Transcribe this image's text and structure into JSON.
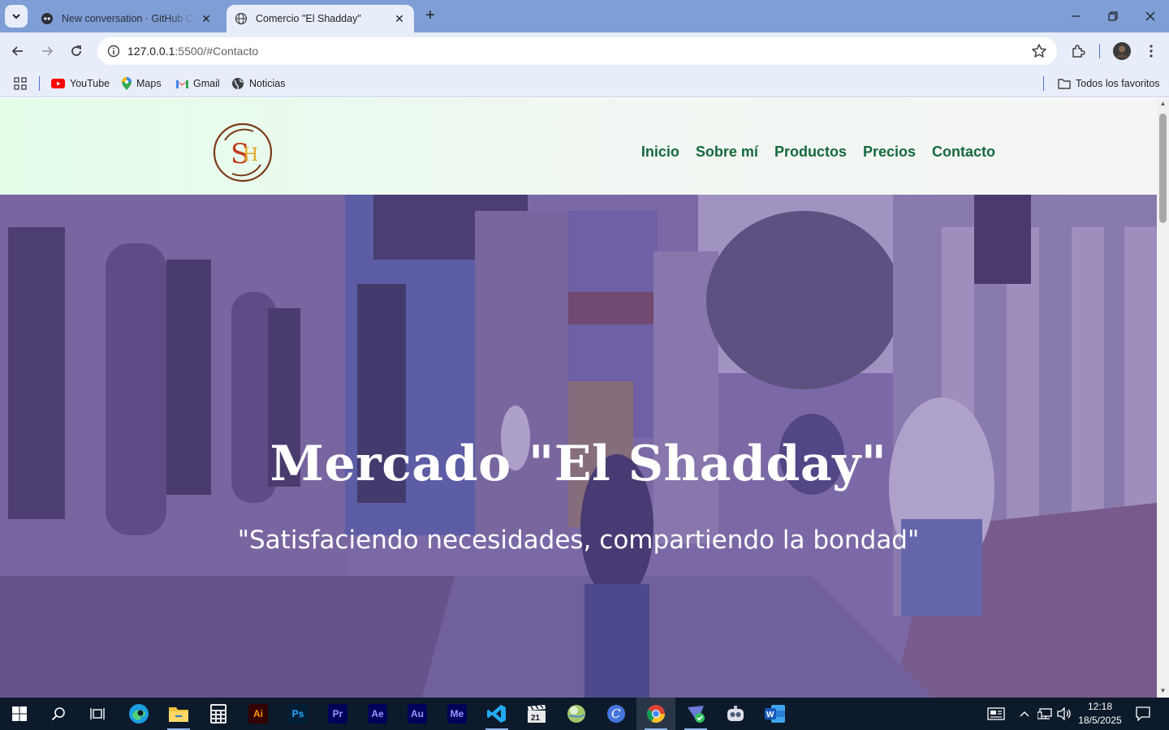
{
  "browser": {
    "tabs": [
      {
        "title": "New conversation · GitHub Copilot",
        "active": false
      },
      {
        "title": "Comercio \"El Shadday\"",
        "active": true
      }
    ],
    "url_host": "127.0.0.1",
    "url_rest": ":5500/#Contacto",
    "bookmarks": [
      "YouTube",
      "Maps",
      "Gmail",
      "Noticias"
    ],
    "all_bookmarks": "Todos los favoritos"
  },
  "site": {
    "logo_text": "SH",
    "nav": [
      "Inicio",
      "Sobre mí",
      "Productos",
      "Precios",
      "Contacto"
    ],
    "hero_title": "Mercado \"El Shadday\"",
    "hero_subtitle": "\"Satisfaciendo necesidades, compartiendo la bondad\""
  },
  "taskbar": {
    "apps": [
      {
        "name": "edge",
        "label": ""
      },
      {
        "name": "file-explorer",
        "label": ""
      },
      {
        "name": "calculator",
        "label": ""
      },
      {
        "name": "illustrator",
        "label": "Ai"
      },
      {
        "name": "photoshop",
        "label": "Ps"
      },
      {
        "name": "premiere",
        "label": "Pr"
      },
      {
        "name": "after-effects",
        "label": "Ae"
      },
      {
        "name": "audition",
        "label": "Au"
      },
      {
        "name": "media-encoder",
        "label": "Me"
      },
      {
        "name": "vscode",
        "label": ""
      },
      {
        "name": "video-editor",
        "label": ""
      },
      {
        "name": "globe-app",
        "label": ""
      },
      {
        "name": "canva",
        "label": ""
      },
      {
        "name": "chrome",
        "label": ""
      },
      {
        "name": "vpn-app",
        "label": ""
      },
      {
        "name": "robot-app",
        "label": ""
      },
      {
        "name": "word",
        "label": ""
      }
    ],
    "time": "12:18",
    "date": "18/5/2025"
  },
  "colors": {
    "nav_green": "#15693d",
    "tabbar": "#7f9ed6",
    "hero_overlay": "#604696"
  }
}
